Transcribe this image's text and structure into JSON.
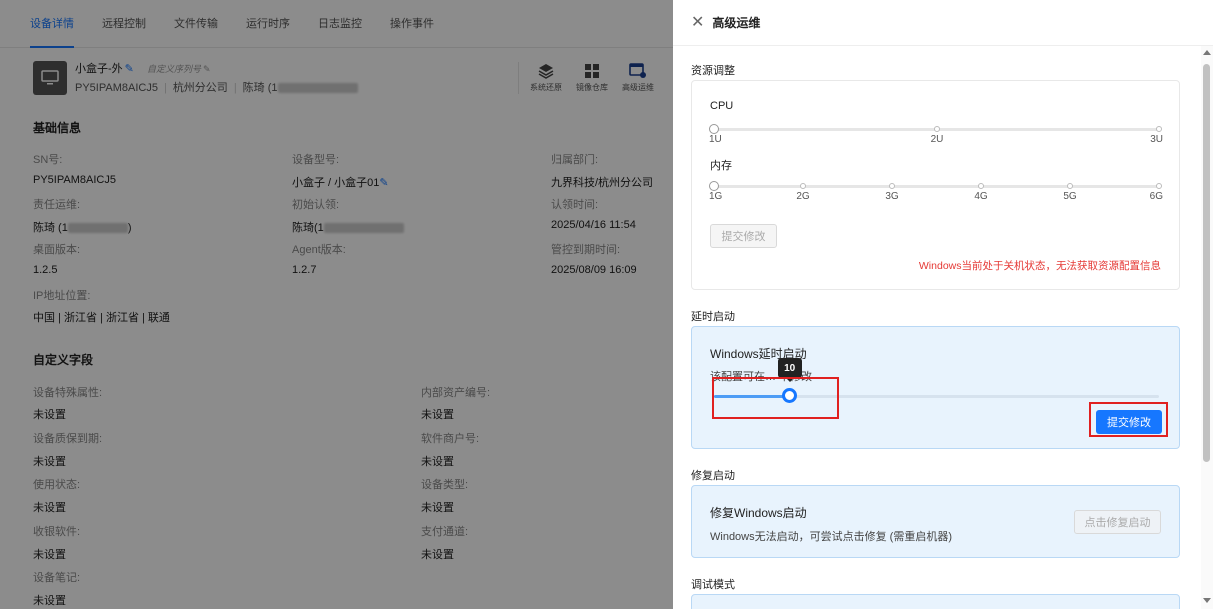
{
  "tabs": [
    "设备详情",
    "远程控制",
    "文件传输",
    "运行时序",
    "日志监控",
    "操作事件"
  ],
  "device": {
    "name": "小盒子-外",
    "serial_placeholder": "自定义序列号",
    "code": "PY5IPAM8AICJ5",
    "company": "杭州分公司",
    "owner": "陈琦 (1"
  },
  "quick_tools": [
    "系统还原",
    "镜像仓库",
    "高级运维"
  ],
  "basic_info": {
    "title": "基础信息",
    "fields": [
      {
        "label": "SN号:",
        "value": "PY5IPAM8AICJ5"
      },
      {
        "label": "设备型号:",
        "value": "小盒子 / 小盒子01"
      },
      {
        "label": "归属部门:",
        "value": "九界科技/杭州分公司"
      },
      {
        "label": "责任运维:",
        "value": "陈琦 (1"
      },
      {
        "label": "初始认领:",
        "value": "陈琦(1"
      },
      {
        "label": "认领时间:",
        "value": "2025/04/16 11:54"
      },
      {
        "label": "桌面版本:",
        "value": "1.2.5"
      },
      {
        "label": "Agent版本:",
        "value": "1.2.7"
      },
      {
        "label": "管控到期时间:",
        "value": "2025/08/09 16:09"
      },
      {
        "label": "IP地址位置:",
        "value": "中国 | 浙江省 | 浙江省 | 联通"
      }
    ]
  },
  "custom_fields": {
    "title": "自定义字段",
    "fields": [
      {
        "label": "设备特殊属性:",
        "value": "未设置"
      },
      {
        "label": "内部资产编号:",
        "value": "未设置"
      },
      {
        "label": "设备质保到期:",
        "value": "未设置"
      },
      {
        "label": "软件商户号:",
        "value": "未设置"
      },
      {
        "label": "使用状态:",
        "value": "未设置"
      },
      {
        "label": "设备类型:",
        "value": "未设置"
      },
      {
        "label": "收银软件:",
        "value": "未设置"
      },
      {
        "label": "支付通道:",
        "value": "未设置"
      },
      {
        "label": "设备笔记:",
        "value": "未设置"
      }
    ]
  },
  "drawer": {
    "title": "高级运维",
    "resource": {
      "section_title": "资源调整",
      "cpu_label": "CPU",
      "cpu_ticks": [
        "1U",
        "2U",
        "3U"
      ],
      "mem_label": "内存",
      "mem_ticks": [
        "1G",
        "2G",
        "3G",
        "4G",
        "5G",
        "6G"
      ],
      "submit": "提交修改",
      "warning": "Windows当前处于关机状态，无法获取资源配置信息"
    },
    "delay": {
      "section_title": "延时启动",
      "title": "Windows延时启动",
      "desc": "该配置可在… 下修改",
      "value": "10",
      "slider_fraction": 0.17,
      "submit": "提交修改"
    },
    "repair": {
      "section_title": "修复启动",
      "title": "修复Windows启动",
      "desc": "Windows无法启动，可尝试点击修复 (需重启机器)",
      "button": "点击修复启动"
    },
    "debug": {
      "section_title": "调试模式"
    }
  },
  "colors": {
    "primary": "#1677ff",
    "warning": "#e53935",
    "highlight": "#e02020",
    "card_blue": "#e8f3fd"
  }
}
